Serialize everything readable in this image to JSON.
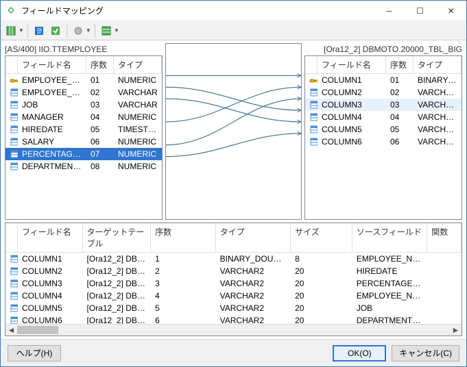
{
  "window": {
    "title": "フィールドマッピング"
  },
  "source": {
    "label": "[AS/400] IIO.TTEMPLOYEE",
    "headers": {
      "name": "フィールド名",
      "ord": "序数",
      "type": "タイプ"
    },
    "rows": [
      {
        "icon": "key",
        "name": "EMPLOYEE_N...",
        "ord": "01",
        "type": "NUMERIC"
      },
      {
        "icon": "col",
        "name": "EMPLOYEE_N...",
        "ord": "02",
        "type": "VARCHAR"
      },
      {
        "icon": "col",
        "name": "JOB",
        "ord": "03",
        "type": "VARCHAR"
      },
      {
        "icon": "col",
        "name": "MANAGER",
        "ord": "04",
        "type": "NUMERIC"
      },
      {
        "icon": "col",
        "name": "HIREDATE",
        "ord": "05",
        "type": "TIMESTMP"
      },
      {
        "icon": "col",
        "name": "SALARY",
        "ord": "06",
        "type": "NUMERIC"
      },
      {
        "icon": "col",
        "name": "PERCENTAGE...",
        "ord": "07",
        "type": "NUMERIC",
        "sel": true
      },
      {
        "icon": "col",
        "name": "DEPARTMENT...",
        "ord": "08",
        "type": "NUMERIC"
      }
    ]
  },
  "target": {
    "label": "[Ora12_2] DBMOTO.20000_TBL_BIG",
    "headers": {
      "name": "フィールド名",
      "ord": "序数",
      "type": "タイプ"
    },
    "rows": [
      {
        "icon": "key",
        "name": "COLUMN1",
        "ord": "01",
        "type": "BINARY_D..."
      },
      {
        "icon": "col",
        "name": "COLUMN2",
        "ord": "02",
        "type": "VARCHAR2"
      },
      {
        "icon": "col",
        "name": "COLUMN3",
        "ord": "03",
        "type": "VARCHAR2",
        "hover": true
      },
      {
        "icon": "col",
        "name": "COLUMN4",
        "ord": "04",
        "type": "VARCHAR2"
      },
      {
        "icon": "col",
        "name": "COLUMN5",
        "ord": "05",
        "type": "VARCHAR2"
      },
      {
        "icon": "col",
        "name": "COLUMN6",
        "ord": "06",
        "type": "VARCHAR2"
      }
    ]
  },
  "mapping_lines": [
    {
      "from": 0,
      "to": 0
    },
    {
      "from": 1,
      "to": 3
    },
    {
      "from": 2,
      "to": 4
    },
    {
      "from": 4,
      "to": 1
    },
    {
      "from": 6,
      "to": 2
    },
    {
      "from": 7,
      "to": 5
    }
  ],
  "bottom": {
    "headers": {
      "name": "フィールド名",
      "tgt": "ターゲットテーブル",
      "ord": "序数",
      "type": "タイプ",
      "size": "サイズ",
      "src": "ソースフィールド",
      "func": "関数"
    },
    "rows": [
      {
        "name": "COLUMN1",
        "tgt": "[Ora12_2] DBM...",
        "ord": "1",
        "type": "BINARY_DOUBLE",
        "size": "8",
        "src": "EMPLOYEE_NU..."
      },
      {
        "name": "COLUMN2",
        "tgt": "[Ora12_2] DBM...",
        "ord": "2",
        "type": "VARCHAR2",
        "size": "20",
        "src": "HIREDATE"
      },
      {
        "name": "COLUMN3",
        "tgt": "[Ora12_2] DBM...",
        "ord": "3",
        "type": "VARCHAR2",
        "size": "20",
        "src": "PERCENTAGE_S..."
      },
      {
        "name": "COLUMN4",
        "tgt": "[Ora12_2] DBM...",
        "ord": "4",
        "type": "VARCHAR2",
        "size": "20",
        "src": "EMPLOYEE_NA..."
      },
      {
        "name": "COLUMN5",
        "tgt": "[Ora12_2] DBM...",
        "ord": "5",
        "type": "VARCHAR2",
        "size": "20",
        "src": "JOB"
      },
      {
        "name": "COLUMN6",
        "tgt": "[Ora12_2] DBM...",
        "ord": "6",
        "type": "VARCHAR2",
        "size": "20",
        "src": "DEPARTMENT_N..."
      }
    ]
  },
  "buttons": {
    "help": "ヘルプ(H)",
    "ok": "OK(O)",
    "cancel": "キャンセル(C)"
  }
}
